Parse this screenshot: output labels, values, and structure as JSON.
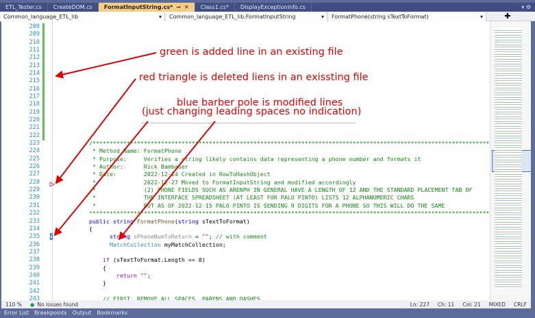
{
  "tabs": [
    "ETL_Tester.cs",
    "CreateDOM.cs",
    "FormatInputString.cs*",
    "Class1.cs*",
    "DisplayExceptionInfo.cs"
  ],
  "active_tab": 2,
  "nav": {
    "project": "Common_language_ETL_lib",
    "class": "Common_language_ETL_lib.FormatInputString",
    "member": "FormatPhone(string sTextToFormat)"
  },
  "annotations": {
    "green": "green is added line in an existing file",
    "red": "red triangle is deleted liens in an exissting file",
    "blue1": "blue barber pole is modified lines",
    "blue2": "(just changing leading spaces no indication)"
  },
  "first_line": 208,
  "code": [
    [],
    [],
    [],
    [],
    [],
    [],
    [],
    [],
    [],
    [],
    [],
    [],
    [],
    [],
    [],
    [
      [
        "/*************************************************************************************************************************",
        "c"
      ]
    ],
    [
      [
        " * Method Name: FormatPhone",
        "c"
      ]
    ],
    [
      [
        " * Purpose:     Verifies a string likely contains data representing a phone number and formats it",
        "c"
      ]
    ],
    [
      [
        " * Author:      Rick Bambauer",
        "c"
      ]
    ],
    [
      [
        " * Date:        2022-12-14 Created in RowToHashObject",
        "c"
      ]
    ],
    [
      [
        " *              2022-12-27 Moved to FormatInputString and modified accordingly",
        "c"
      ]
    ],
    [
      [
        " *              (2) PHONE FIELDS SUCH AS ARENPH IN GENERAL HAVE A LENGTH OF 12 AND THE STANDARD PLACEMENT TAB OF",
        "c"
      ]
    ],
    [
      [
        " *              THE INTERFACE SPREADSHEET (AT LEAST FOR PALO PINTO) LISTS 12 ALPHANUMERIC CHARS",
        "c"
      ]
    ],
    [
      [
        " *              BUT AS OF 2022-12-15 PALO PINTO IS SENDING 9 DIGITS FOR A PHONE SO THIS WILL DO THE SAME",
        "c"
      ]
    ],
    [
      [
        "*************************************************************************************************************************/",
        "c"
      ]
    ],
    [
      [
        "public string ",
        "k"
      ],
      [
        "FormatPhone",
        "m"
      ],
      [
        "(",
        "x"
      ],
      [
        "string ",
        "k"
      ],
      [
        "sTextToFormat)",
        "x"
      ]
    ],
    [
      [
        "{",
        "x"
      ]
    ],
    [
      [
        "      string ",
        "k"
      ],
      [
        "sPhoneNumToReturn",
        "g"
      ],
      [
        " = ",
        "x"
      ],
      [
        "\"\"",
        "s"
      ],
      [
        "; ",
        "x"
      ],
      [
        "// with comment",
        "c"
      ]
    ],
    [
      [
        "      MatchCollection ",
        "t"
      ],
      [
        "myMatchCollection;",
        "x"
      ]
    ],
    [],
    [
      [
        "    if ",
        "p"
      ],
      [
        "(sTextToFormat.Length == 0)",
        "x"
      ]
    ],
    [
      [
        "    {",
        "x"
      ]
    ],
    [
      [
        "        return ",
        "p"
      ],
      [
        "\"\"",
        "s"
      ],
      [
        ";",
        "x"
      ]
    ],
    [
      [
        "    }",
        "x"
      ]
    ],
    [],
    [
      [
        "    // FIRST, REMOVE ALL SPACES, PARENS AND DASHES",
        "c"
      ]
    ]
  ],
  "status": {
    "zoom": "110 %",
    "issues": "No issues found",
    "ln": "Ln: 227",
    "ch": "Ch: 11",
    "col": "Col: 21",
    "indent": "MIXED",
    "eol": "CRLF"
  },
  "bottom_tabs": [
    "Error List",
    "Breakpoints",
    "Output",
    "Bookmarks"
  ],
  "colors": {
    "added": "#5bbf5b",
    "deleted": "#e04040",
    "modified": "#1e88e5",
    "annotation": "#e00000"
  }
}
